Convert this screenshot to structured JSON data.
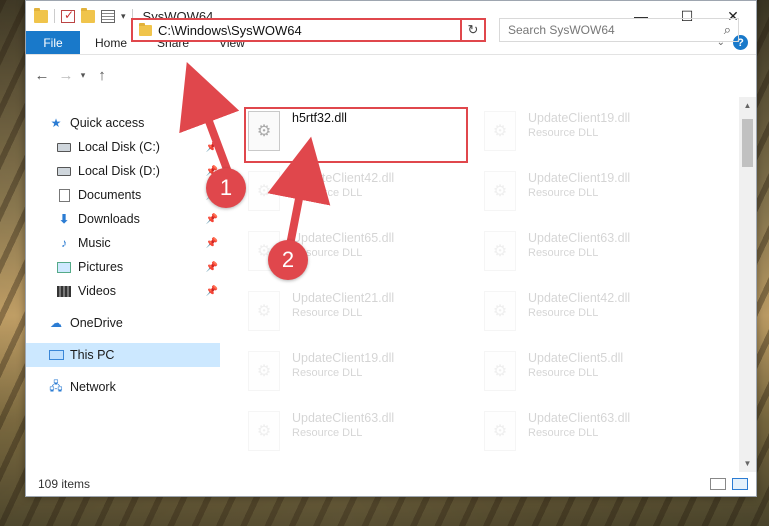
{
  "window": {
    "title": "SysWOW64",
    "controls": {
      "minimize": "—",
      "maximize": "☐",
      "close": "✕"
    }
  },
  "ribbon": {
    "file_tab": "File",
    "tabs": [
      "Home",
      "Share",
      "View"
    ],
    "help": "?"
  },
  "address": {
    "path": "C:\\Windows\\SysWOW64",
    "search_placeholder": "Search SysWOW64"
  },
  "sidebar": {
    "quick_access": "Quick access",
    "items": [
      {
        "label": "Local Disk (C:)",
        "icon": "drive-icon",
        "pinned": true
      },
      {
        "label": "Local Disk (D:)",
        "icon": "drive-icon",
        "pinned": true
      },
      {
        "label": "Documents",
        "icon": "documents-icon",
        "pinned": true
      },
      {
        "label": "Downloads",
        "icon": "downloads-icon",
        "pinned": true
      },
      {
        "label": "Music",
        "icon": "music-icon",
        "pinned": true
      },
      {
        "label": "Pictures",
        "icon": "pictures-icon",
        "pinned": true
      },
      {
        "label": "Videos",
        "icon": "videos-icon",
        "pinned": true
      }
    ],
    "onedrive": "OneDrive",
    "this_pc": "This PC",
    "network": "Network"
  },
  "files": [
    {
      "name": "h5rtf32.dll",
      "type": "",
      "highlighted": true
    },
    {
      "name": "UpdateClient19.dll",
      "type": "Resource DLL"
    },
    {
      "name": "UpdateClient42.dll",
      "type": "Resource DLL"
    },
    {
      "name": "UpdateClient19.dll",
      "type": "Resource DLL"
    },
    {
      "name": "UpdateClient65.dll",
      "type": "Resource DLL"
    },
    {
      "name": "UpdateClient63.dll",
      "type": "Resource DLL"
    },
    {
      "name": "UpdateClient21.dll",
      "type": "Resource DLL"
    },
    {
      "name": "UpdateClient42.dll",
      "type": "Resource DLL"
    },
    {
      "name": "UpdateClient19.dll",
      "type": "Resource DLL"
    },
    {
      "name": "UpdateClient5.dll",
      "type": "Resource DLL"
    },
    {
      "name": "UpdateClient63.dll",
      "type": "Resource DLL"
    },
    {
      "name": "UpdateClient63.dll",
      "type": "Resource DLL"
    }
  ],
  "status": {
    "item_count": "109 items"
  },
  "annotations": {
    "step1": "1",
    "step2": "2",
    "color": "#e0474c"
  }
}
